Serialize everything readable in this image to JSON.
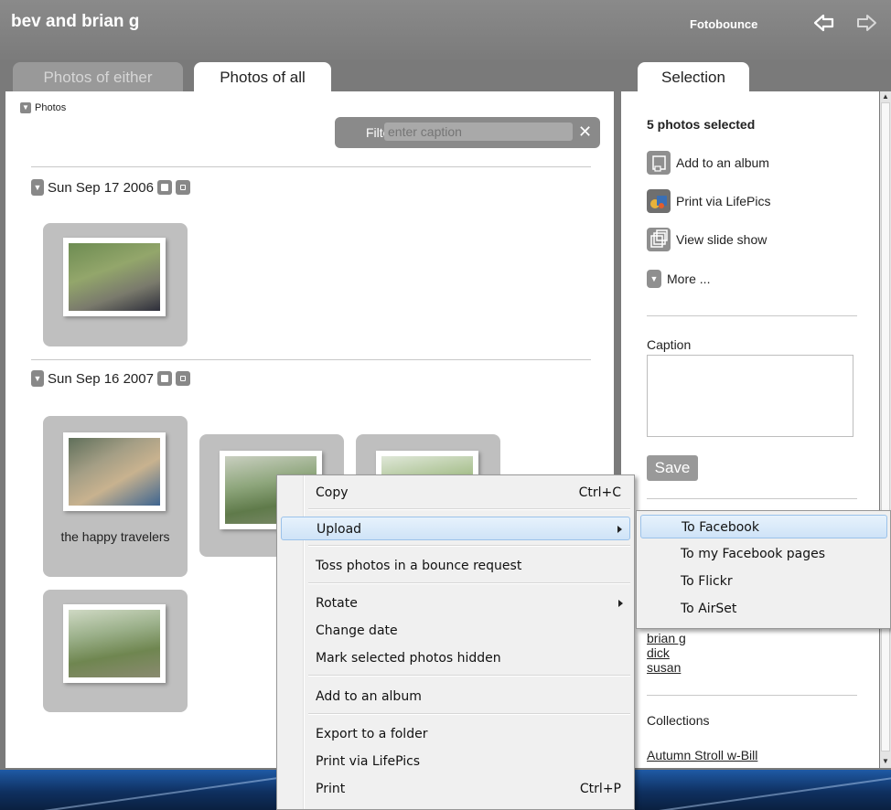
{
  "window": {
    "title": "bev and brian g",
    "brand": "Fotobounce",
    "back_icon": "back-arrow-icon",
    "forward_icon": "forward-arrow-icon"
  },
  "tabs": [
    {
      "label": "Photos of either",
      "active": false
    },
    {
      "label": "Photos of all",
      "active": true
    }
  ],
  "main": {
    "section_label": "Photos",
    "filter": {
      "label": "Filter",
      "placeholder": "enter caption",
      "clear_icon": "close-icon"
    },
    "groups": [
      {
        "date": "Sun Sep 17 2006",
        "photos": [
          {
            "caption": ""
          }
        ]
      },
      {
        "date": "Sun Sep 16 2007",
        "photos": [
          {
            "caption": "the happy travelers"
          },
          {
            "caption": ""
          },
          {
            "caption": ""
          },
          {
            "caption": ""
          }
        ]
      }
    ]
  },
  "selection_panel": {
    "tab_label": "Selection",
    "count_text": "5 photos selected",
    "actions": [
      {
        "label": "Add to an album",
        "icon": "album-icon"
      },
      {
        "label": "Print via LifePics",
        "icon": "lifepics-icon"
      },
      {
        "label": "View slide show",
        "icon": "slideshow-icon"
      },
      {
        "label": "More ...",
        "icon": "chevron-down-icon"
      }
    ],
    "caption_label": "Caption",
    "caption_value": "",
    "save_label": "Save",
    "people": [
      "brian g",
      "dick",
      "susan "
    ],
    "collections_label": "Collections",
    "collections": [
      "Autumn Stroll w-Bill"
    ]
  },
  "context_menu": {
    "items": [
      {
        "label": "Copy",
        "shortcut": "Ctrl+C"
      },
      {
        "label": "Upload",
        "submenu": true,
        "highlighted": true
      },
      {
        "label": "Toss photos in a bounce request"
      },
      {
        "label": "Rotate",
        "submenu": true
      },
      {
        "label": "Change date"
      },
      {
        "label": "Mark selected photos hidden"
      },
      {
        "label": "Add to an album"
      },
      {
        "label": "Export to a folder"
      },
      {
        "label": "Print via LifePics"
      },
      {
        "label": "Print",
        "shortcut": "Ctrl+P"
      }
    ]
  },
  "upload_submenu": {
    "items": [
      "To Facebook",
      "To my Facebook pages",
      "To Flickr",
      "To AirSet"
    ]
  }
}
